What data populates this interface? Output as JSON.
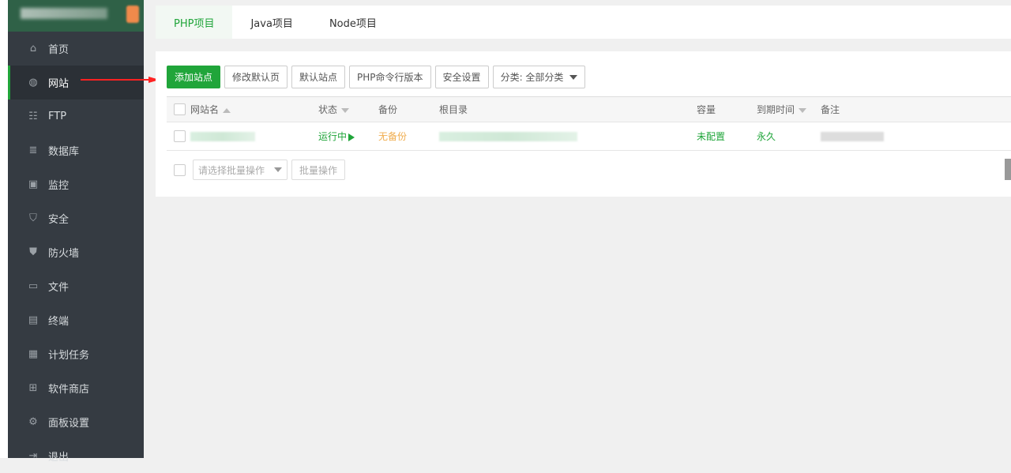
{
  "sidebar": {
    "items": [
      {
        "label": "首页",
        "icon": "home-icon"
      },
      {
        "label": "网站",
        "icon": "globe-icon"
      },
      {
        "label": "FTP",
        "icon": "ftp-icon"
      },
      {
        "label": "数据库",
        "icon": "database-icon"
      },
      {
        "label": "监控",
        "icon": "monitor-icon"
      },
      {
        "label": "安全",
        "icon": "shield-icon"
      },
      {
        "label": "防火墙",
        "icon": "firewall-icon"
      },
      {
        "label": "文件",
        "icon": "folder-icon"
      },
      {
        "label": "终端",
        "icon": "terminal-icon"
      },
      {
        "label": "计划任务",
        "icon": "calendar-icon"
      },
      {
        "label": "软件商店",
        "icon": "apps-icon"
      },
      {
        "label": "面板设置",
        "icon": "gear-icon"
      },
      {
        "label": "退出",
        "icon": "logout-icon"
      }
    ],
    "active": "网站"
  },
  "tabs": [
    "PHP项目",
    "Java项目",
    "Node项目"
  ],
  "toolbar": {
    "add_site": "添加站点",
    "modify_default_page": "修改默认页",
    "default_site": "默认站点",
    "php_cli_version": "PHP命令行版本",
    "security_settings": "安全设置",
    "category": "分类: 全部分类"
  },
  "table": {
    "headers": [
      "网站名",
      "状态",
      "备份",
      "根目录",
      "容量",
      "到期时间",
      "备注"
    ],
    "rows": [
      {
        "status": "运行中",
        "backup": "无备份",
        "capacity": "未配置",
        "expiry": "永久"
      }
    ]
  },
  "batch": {
    "placeholder": "请选择批量操作",
    "button": "批量操作"
  },
  "colors": {
    "accent": "#20a53a",
    "sidebar": "#353b42",
    "warning": "#f0ad4e"
  }
}
